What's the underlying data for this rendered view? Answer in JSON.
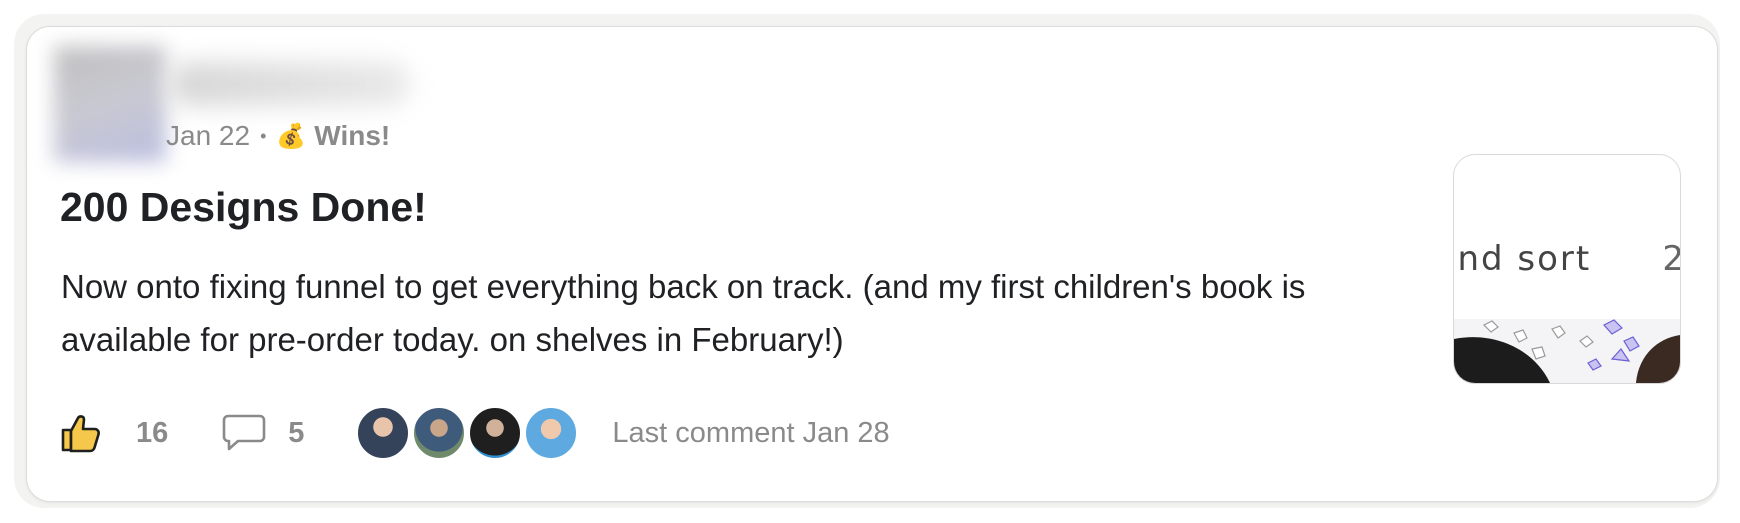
{
  "post": {
    "date": "Jan 22",
    "separator": "•",
    "category_emoji": "💰",
    "category": "Wins!",
    "title": "200 Designs Done!",
    "body": "Now onto fixing funnel to get everything back on track. (and my first children's book is available for pre-order today. on shelves in February!)"
  },
  "stats": {
    "likes": "16",
    "comments": "5",
    "last_comment": "Last comment Jan 28"
  },
  "thumbnail": {
    "text_left": "ınd sort",
    "text_right": "2"
  },
  "icons": {
    "like": "thumbs-up-icon",
    "comment": "comment-bubble-icon"
  },
  "colors": {
    "like_icon_fill": "#f5c84b",
    "muted_text": "#8a8a8a",
    "title_text": "#202124"
  }
}
